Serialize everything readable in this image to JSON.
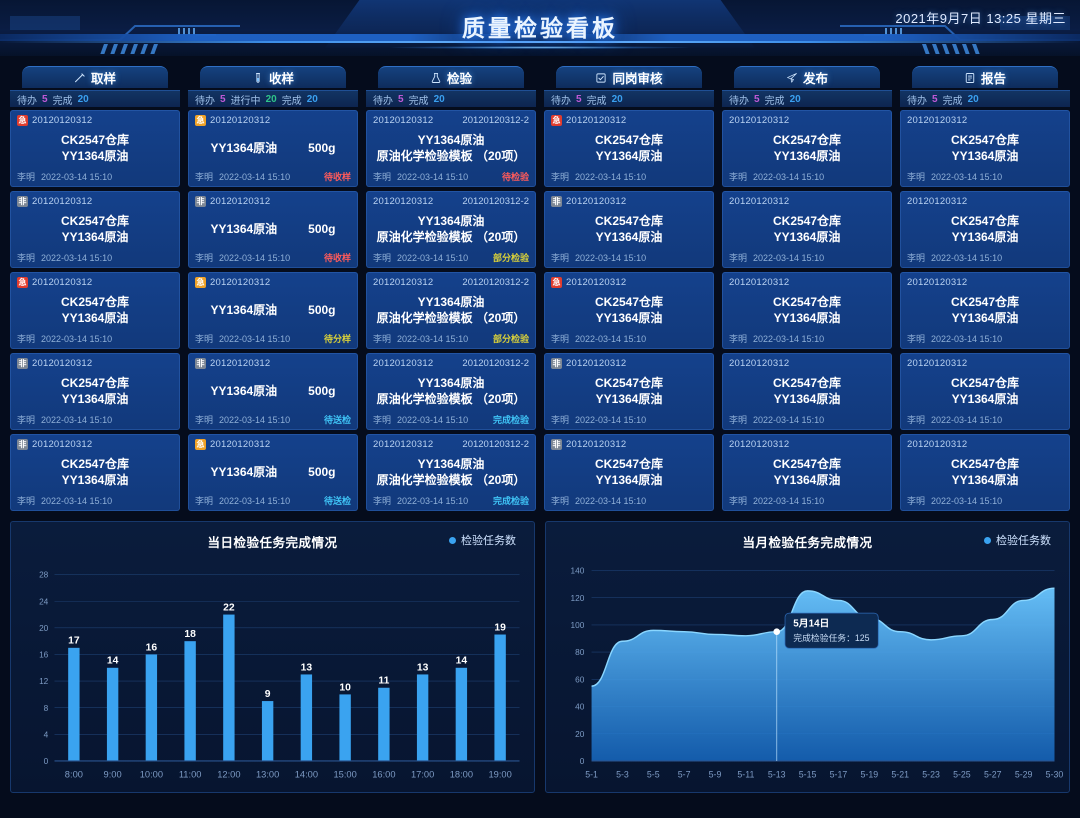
{
  "header": {
    "title": "质量检验看板",
    "datetime": "2021年9月7日 13:25  星期三"
  },
  "board": {
    "status_labels": {
      "todo": "待办",
      "doing": "进行中",
      "done": "完成"
    },
    "columns": [
      {
        "name": "取样",
        "icon": "sampling-icon",
        "stats": [
          {
            "label": "待办",
            "value": "5",
            "kind": "todo"
          },
          {
            "label": "完成",
            "value": "20",
            "kind": "done"
          }
        ],
        "cards": [
          {
            "badge": "急",
            "badge_kind": "urgent",
            "id": "20120120312",
            "line1": "CK2547仓库",
            "line2": "YY1364原油",
            "user": "李明",
            "time": "2022-03-14  15:10",
            "status": "",
            "status_kind": ""
          },
          {
            "badge": "非",
            "badge_kind": "normal",
            "id": "20120120312",
            "line1": "CK2547仓库",
            "line2": "YY1364原油",
            "user": "李明",
            "time": "2022-03-14  15:10",
            "status": "",
            "status_kind": ""
          },
          {
            "badge": "急",
            "badge_kind": "urgent",
            "id": "20120120312",
            "line1": "CK2547仓库",
            "line2": "YY1364原油",
            "user": "李明",
            "time": "2022-03-14  15:10",
            "status": "",
            "status_kind": ""
          },
          {
            "badge": "非",
            "badge_kind": "normal",
            "id": "20120120312",
            "line1": "CK2547仓库",
            "line2": "YY1364原油",
            "user": "李明",
            "time": "2022-03-14  15:10",
            "status": "",
            "status_kind": ""
          },
          {
            "badge": "非",
            "badge_kind": "normal",
            "id": "20120120312",
            "line1": "CK2547仓库",
            "line2": "YY1364原油",
            "user": "李明",
            "time": "2022-03-14  15:10",
            "status": "",
            "status_kind": ""
          }
        ]
      },
      {
        "name": "收样",
        "icon": "test-tube-icon",
        "stats": [
          {
            "label": "待办",
            "value": "5",
            "kind": "todo"
          },
          {
            "label": "进行中",
            "value": "20",
            "kind": "doing"
          },
          {
            "label": "完成",
            "value": "20",
            "kind": "done"
          }
        ],
        "cards": [
          {
            "badge": "急",
            "badge_kind": "orange",
            "id": "20120120312",
            "line1": "YY1364原油",
            "line2": "500g",
            "user": "李明",
            "time": "2022-03-14  15:10",
            "status": "待收样",
            "status_kind": "s-red"
          },
          {
            "badge": "非",
            "badge_kind": "normal",
            "id": "20120120312",
            "line1": "YY1364原油",
            "line2": "500g",
            "user": "李明",
            "time": "2022-03-14  15:10",
            "status": "待收样",
            "status_kind": "s-red"
          },
          {
            "badge": "急",
            "badge_kind": "orange",
            "id": "20120120312",
            "line1": "YY1364原油",
            "line2": "500g",
            "user": "李明",
            "time": "2022-03-14  15:10",
            "status": "待分样",
            "status_kind": "s-yellow"
          },
          {
            "badge": "非",
            "badge_kind": "normal",
            "id": "20120120312",
            "line1": "YY1364原油",
            "line2": "500g",
            "user": "李明",
            "time": "2022-03-14  15:10",
            "status": "待送检",
            "status_kind": "s-cyan"
          },
          {
            "badge": "急",
            "badge_kind": "orange",
            "id": "20120120312",
            "line1": "YY1364原油",
            "line2": "500g",
            "user": "李明",
            "time": "2022-03-14  15:10",
            "status": "待送检",
            "status_kind": "s-cyan"
          }
        ]
      },
      {
        "name": "检验",
        "icon": "flask-icon",
        "stats": [
          {
            "label": "待办",
            "value": "5",
            "kind": "todo"
          },
          {
            "label": "完成",
            "value": "20",
            "kind": "done"
          }
        ],
        "cards": [
          {
            "badge": "",
            "badge_kind": "",
            "id": "20120120312",
            "id2": "20120120312-2",
            "line1": "YY1364原油",
            "line2": "原油化学检验模板 （20项）",
            "user": "李明",
            "time": "2022-03-14  15:10",
            "status": "待检验",
            "status_kind": "s-red"
          },
          {
            "badge": "",
            "badge_kind": "",
            "id": "20120120312",
            "id2": "20120120312-2",
            "line1": "YY1364原油",
            "line2": "原油化学检验模板 （20项）",
            "user": "李明",
            "time": "2022-03-14  15:10",
            "status": "部分检验",
            "status_kind": "s-yellow"
          },
          {
            "badge": "",
            "badge_kind": "",
            "id": "20120120312",
            "id2": "20120120312-2",
            "line1": "YY1364原油",
            "line2": "原油化学检验模板 （20项）",
            "user": "李明",
            "time": "2022-03-14  15:10",
            "status": "部分检验",
            "status_kind": "s-yellow"
          },
          {
            "badge": "",
            "badge_kind": "",
            "id": "20120120312",
            "id2": "20120120312-2",
            "line1": "YY1364原油",
            "line2": "原油化学检验模板 （20项）",
            "user": "李明",
            "time": "2022-03-14  15:10",
            "status": "完成检验",
            "status_kind": "s-cyan"
          },
          {
            "badge": "",
            "badge_kind": "",
            "id": "20120120312",
            "id2": "20120120312-2",
            "line1": "YY1364原油",
            "line2": "原油化学检验模板 （20项）",
            "user": "李明",
            "time": "2022-03-14  15:10",
            "status": "完成检验",
            "status_kind": "s-cyan"
          }
        ]
      },
      {
        "name": "同岗审核",
        "icon": "review-icon",
        "stats": [
          {
            "label": "待办",
            "value": "5",
            "kind": "todo"
          },
          {
            "label": "完成",
            "value": "20",
            "kind": "done"
          }
        ],
        "cards": [
          {
            "badge": "急",
            "badge_kind": "urgent",
            "id": "20120120312",
            "line1": "CK2547仓库",
            "line2": "YY1364原油",
            "user": "李明",
            "time": "2022-03-14  15:10",
            "status": "",
            "status_kind": ""
          },
          {
            "badge": "非",
            "badge_kind": "normal",
            "id": "20120120312",
            "line1": "CK2547仓库",
            "line2": "YY1364原油",
            "user": "李明",
            "time": "2022-03-14  15:10",
            "status": "",
            "status_kind": ""
          },
          {
            "badge": "急",
            "badge_kind": "urgent",
            "id": "20120120312",
            "line1": "CK2547仓库",
            "line2": "YY1364原油",
            "user": "李明",
            "time": "2022-03-14  15:10",
            "status": "",
            "status_kind": ""
          },
          {
            "badge": "非",
            "badge_kind": "normal",
            "id": "20120120312",
            "line1": "CK2547仓库",
            "line2": "YY1364原油",
            "user": "李明",
            "time": "2022-03-14  15:10",
            "status": "",
            "status_kind": ""
          },
          {
            "badge": "非",
            "badge_kind": "normal",
            "id": "20120120312",
            "line1": "CK2547仓库",
            "line2": "YY1364原油",
            "user": "李明",
            "time": "2022-03-14  15:10",
            "status": "",
            "status_kind": ""
          }
        ]
      },
      {
        "name": "发布",
        "icon": "send-icon",
        "stats": [
          {
            "label": "待办",
            "value": "5",
            "kind": "todo"
          },
          {
            "label": "完成",
            "value": "20",
            "kind": "done"
          }
        ],
        "cards": [
          {
            "badge": "",
            "badge_kind": "",
            "id": "20120120312",
            "line1": "CK2547仓库",
            "line2": "YY1364原油",
            "user": "李明",
            "time": "2022-03-14  15:10",
            "status": "",
            "status_kind": ""
          },
          {
            "badge": "",
            "badge_kind": "",
            "id": "20120120312",
            "line1": "CK2547仓库",
            "line2": "YY1364原油",
            "user": "李明",
            "time": "2022-03-14  15:10",
            "status": "",
            "status_kind": ""
          },
          {
            "badge": "",
            "badge_kind": "",
            "id": "20120120312",
            "line1": "CK2547仓库",
            "line2": "YY1364原油",
            "user": "李明",
            "time": "2022-03-14  15:10",
            "status": "",
            "status_kind": ""
          },
          {
            "badge": "",
            "badge_kind": "",
            "id": "20120120312",
            "line1": "CK2547仓库",
            "line2": "YY1364原油",
            "user": "李明",
            "time": "2022-03-14  15:10",
            "status": "",
            "status_kind": ""
          },
          {
            "badge": "",
            "badge_kind": "",
            "id": "20120120312",
            "line1": "CK2547仓库",
            "line2": "YY1364原油",
            "user": "李明",
            "time": "2022-03-14  15:10",
            "status": "",
            "status_kind": ""
          }
        ]
      },
      {
        "name": "报告",
        "icon": "report-icon",
        "stats": [
          {
            "label": "待办",
            "value": "5",
            "kind": "todo"
          },
          {
            "label": "完成",
            "value": "20",
            "kind": "done"
          }
        ],
        "cards": [
          {
            "badge": "",
            "badge_kind": "",
            "id": "20120120312",
            "line1": "CK2547仓库",
            "line2": "YY1364原油",
            "user": "李明",
            "time": "2022-03-14  15:10",
            "status": "",
            "status_kind": ""
          },
          {
            "badge": "",
            "badge_kind": "",
            "id": "20120120312",
            "line1": "CK2547仓库",
            "line2": "YY1364原油",
            "user": "李明",
            "time": "2022-03-14  15:10",
            "status": "",
            "status_kind": ""
          },
          {
            "badge": "",
            "badge_kind": "",
            "id": "20120120312",
            "line1": "CK2547仓库",
            "line2": "YY1364原油",
            "user": "李明",
            "time": "2022-03-14  15:10",
            "status": "",
            "status_kind": ""
          },
          {
            "badge": "",
            "badge_kind": "",
            "id": "20120120312",
            "line1": "CK2547仓库",
            "line2": "YY1364原油",
            "user": "李明",
            "time": "2022-03-14  15:10",
            "status": "",
            "status_kind": ""
          },
          {
            "badge": "",
            "badge_kind": "",
            "id": "20120120312",
            "line1": "CK2547仓库",
            "line2": "YY1364原油",
            "user": "李明",
            "time": "2022-03-14  15:10",
            "status": "",
            "status_kind": ""
          }
        ]
      }
    ]
  },
  "chart_data": [
    {
      "type": "bar",
      "title": "当日检验任务完成情况",
      "legend": [
        "检验任务数"
      ],
      "legend_position": "top-right",
      "categories": [
        "8:00",
        "9:00",
        "10:00",
        "11:00",
        "12:00",
        "13:00",
        "14:00",
        "15:00",
        "16:00",
        "17:00",
        "18:00",
        "19:00"
      ],
      "values": [
        17,
        14,
        16,
        18,
        22,
        9,
        13,
        10,
        11,
        13,
        14,
        19
      ],
      "yticks": [
        0,
        4,
        8,
        12,
        16,
        20,
        24,
        28
      ],
      "ylim": [
        0,
        28
      ],
      "xlabel": "",
      "ylabel": "",
      "grid": true,
      "color": "#3aa3f0"
    },
    {
      "type": "area",
      "title": "当月检验任务完成情况",
      "legend": [
        "检验任务数"
      ],
      "legend_position": "top-right",
      "categories": [
        "5-1",
        "5-3",
        "5-5",
        "5-7",
        "5-9",
        "5-11",
        "5-13",
        "5-15",
        "5-17",
        "5-19",
        "5-21",
        "5-23",
        "5-25",
        "5-27",
        "5-29",
        "5-30"
      ],
      "values": [
        55,
        88,
        96,
        95,
        93,
        92,
        95,
        125,
        118,
        105,
        95,
        89,
        92,
        104,
        118,
        127
      ],
      "yticks": [
        0,
        20,
        40,
        60,
        80,
        100,
        120,
        140
      ],
      "ylim": [
        0,
        140
      ],
      "xlabel": "",
      "ylabel": "",
      "grid": true,
      "color": "#35a6ef",
      "annotation": {
        "x": "5-13",
        "title": "5月14日",
        "text": "完成检验任务：125",
        "value": 125
      }
    }
  ]
}
